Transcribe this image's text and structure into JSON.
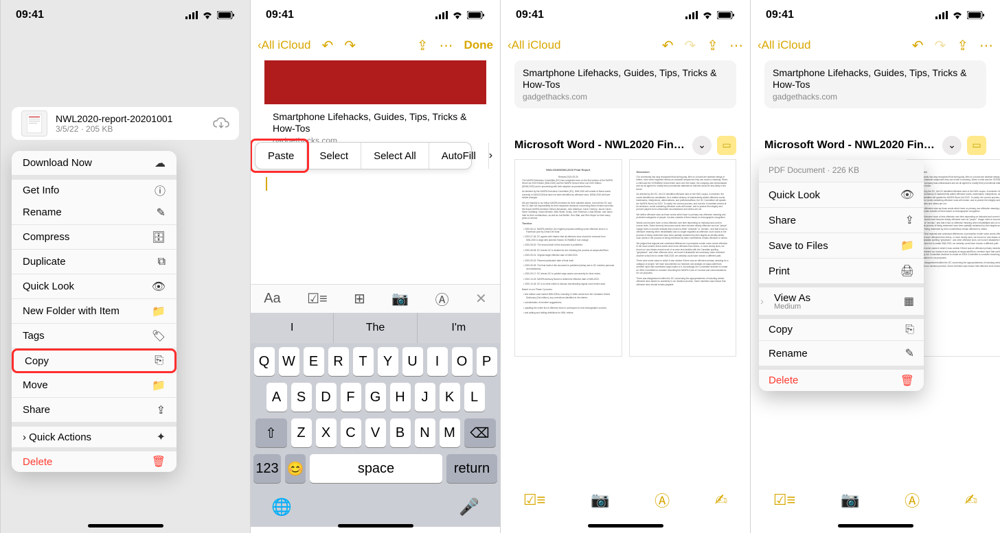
{
  "status": {
    "time": "09:41"
  },
  "nav": {
    "back_label": "All iCloud",
    "done_label": "Done"
  },
  "screen1": {
    "file_name": "NWL2020-report-20201001",
    "file_meta": "3/5/22 · 205 KB",
    "menu": {
      "download_now": "Download Now",
      "get_info": "Get Info",
      "rename": "Rename",
      "compress": "Compress",
      "duplicate": "Duplicate",
      "quick_look": "Quick Look",
      "new_folder": "New Folder with Item",
      "tags": "Tags",
      "copy": "Copy",
      "move": "Move",
      "share": "Share",
      "quick_actions": "Quick Actions",
      "delete": "Delete"
    }
  },
  "link_preview": {
    "title": "Smartphone Lifehacks, Guides, Tips, Tricks & How-Tos",
    "subtitle": "gadgethacks.com"
  },
  "screen2": {
    "edit_popover": {
      "paste": "Paste",
      "select": "Select",
      "select_all": "Select All",
      "autofill": "AutoFill"
    },
    "keyboard": {
      "suggest": [
        "I",
        "The",
        "I'm"
      ],
      "row1": [
        "Q",
        "W",
        "E",
        "R",
        "T",
        "Y",
        "U",
        "I",
        "O",
        "P"
      ],
      "row2": [
        "A",
        "S",
        "D",
        "F",
        "G",
        "H",
        "J",
        "K",
        "L"
      ],
      "row3": [
        "Z",
        "X",
        "C",
        "V",
        "B",
        "N",
        "M"
      ],
      "num_key": "123",
      "space_key": "space",
      "return_key": "return"
    }
  },
  "pdf": {
    "title": "Microsoft Word - NWL2020 Fin…",
    "doc_meta": "PDF Document · 226 KB",
    "page1": {
      "header": "NWL2020/NSWL2020 Final Report",
      "date": "Revised 2020-09-30",
      "timeline_label": "Timeline"
    },
    "page2": {
      "header": "Discussion"
    }
  },
  "pop4": {
    "quick_look": "Quick Look",
    "share": "Share",
    "save_to_files": "Save to Files",
    "print": "Print",
    "view_as": "View As",
    "view_as_sub": "Medium",
    "copy": "Copy",
    "rename": "Rename",
    "delete": "Delete"
  }
}
